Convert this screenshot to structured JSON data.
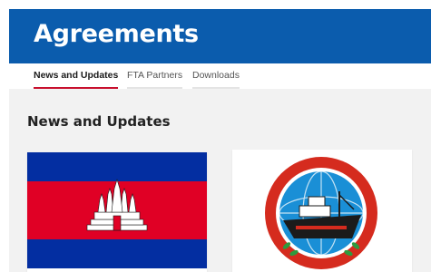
{
  "header": {
    "title": "Agreements"
  },
  "tabs": [
    {
      "label": "News and Updates",
      "active": true
    },
    {
      "label": "FTA Partners",
      "active": false
    },
    {
      "label": "Downloads",
      "active": false
    }
  ],
  "main": {
    "section_title": "News and Updates",
    "cards": [
      {
        "image": "cambodia-flag"
      },
      {
        "image": "ministry-of-commerce-logo"
      }
    ]
  },
  "colors": {
    "banner": "#0b5cad",
    "active_tab_underline": "#c8102e",
    "flag_blue": "#032ea1",
    "flag_red": "#e00025",
    "logo_ring": "#d52b1e",
    "logo_inner": "#1a8fd6"
  }
}
